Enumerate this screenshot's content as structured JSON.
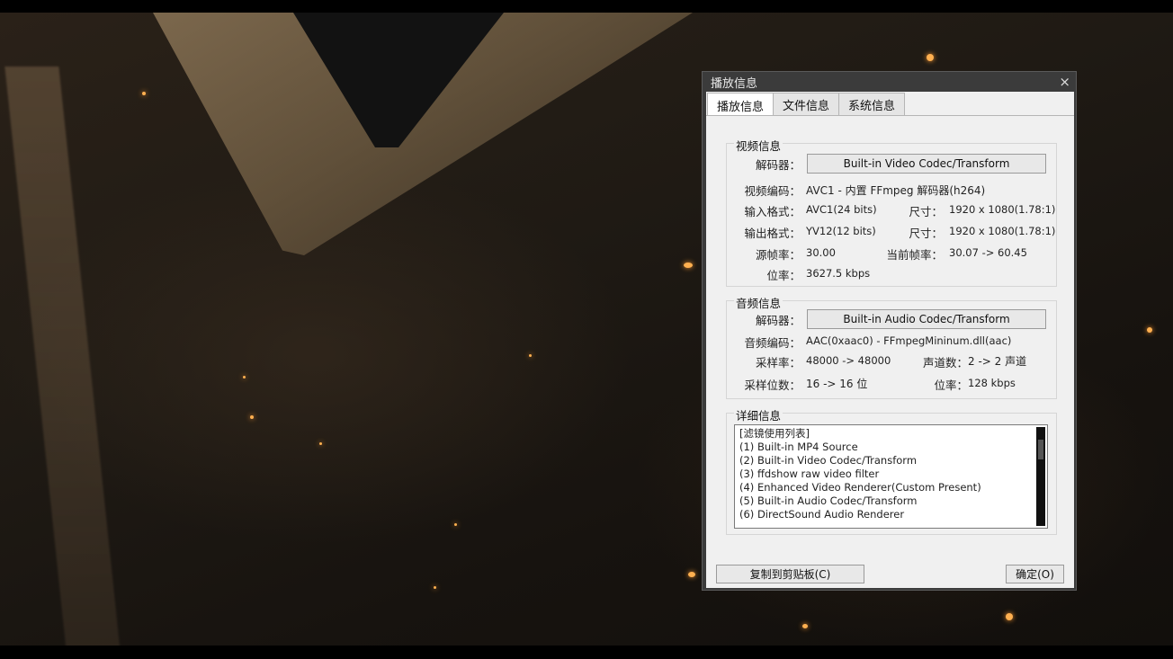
{
  "dialog": {
    "title": "播放信息",
    "close_icon": "×",
    "tabs": [
      "播放信息",
      "文件信息",
      "系统信息"
    ],
    "video": {
      "group_title": "视频信息",
      "decoder_label": "解码器：",
      "decoder_button": "Built-in Video Codec/Transform",
      "codec_label": "视频编码：",
      "codec_value": "AVC1 - 内置 FFmpeg 解码器(h264)",
      "input_label": "输入格式：",
      "input_value": "AVC1(24 bits)",
      "input_size_label": "尺寸：",
      "input_size_value": "1920 x 1080(1.78:1)",
      "output_label": "输出格式：",
      "output_value": "YV12(12 bits)",
      "output_size_label": "尺寸：",
      "output_size_value": "1920 x 1080(1.78:1)",
      "src_fps_label": "源帧率：",
      "src_fps_value": "30.00",
      "cur_fps_label": "当前帧率：",
      "cur_fps_value": "30.07 -> 60.45",
      "bitrate_label": "位率：",
      "bitrate_value": "3627.5 kbps"
    },
    "audio": {
      "group_title": "音频信息",
      "decoder_label": "解码器：",
      "decoder_button": "Built-in Audio Codec/Transform",
      "codec_label": "音频编码：",
      "codec_value": "AAC(0xaac0) - FFmpegMininum.dll(aac)",
      "samplerate_label": "采样率：",
      "samplerate_value": "48000 -> 48000",
      "channels_label": "声道数：",
      "channels_value": "2 -> 2 声道",
      "bits_label": "采样位数：",
      "bits_value": "16 -> 16 位",
      "bitrate_label": "位率：",
      "bitrate_value": "128 kbps"
    },
    "details": {
      "group_title": "详细信息",
      "lines": [
        "[滤镜使用列表]",
        "(1) Built-in MP4 Source",
        "(2) Built-in Video Codec/Transform",
        "(3) ffdshow raw video filter",
        "(4) Enhanced Video Renderer(Custom Present)",
        "(5) Built-in Audio Codec/Transform",
        "(6) DirectSound Audio Renderer"
      ]
    },
    "copy_button": "复制到剪贴板(C)",
    "ok_button": "确定(O)"
  }
}
